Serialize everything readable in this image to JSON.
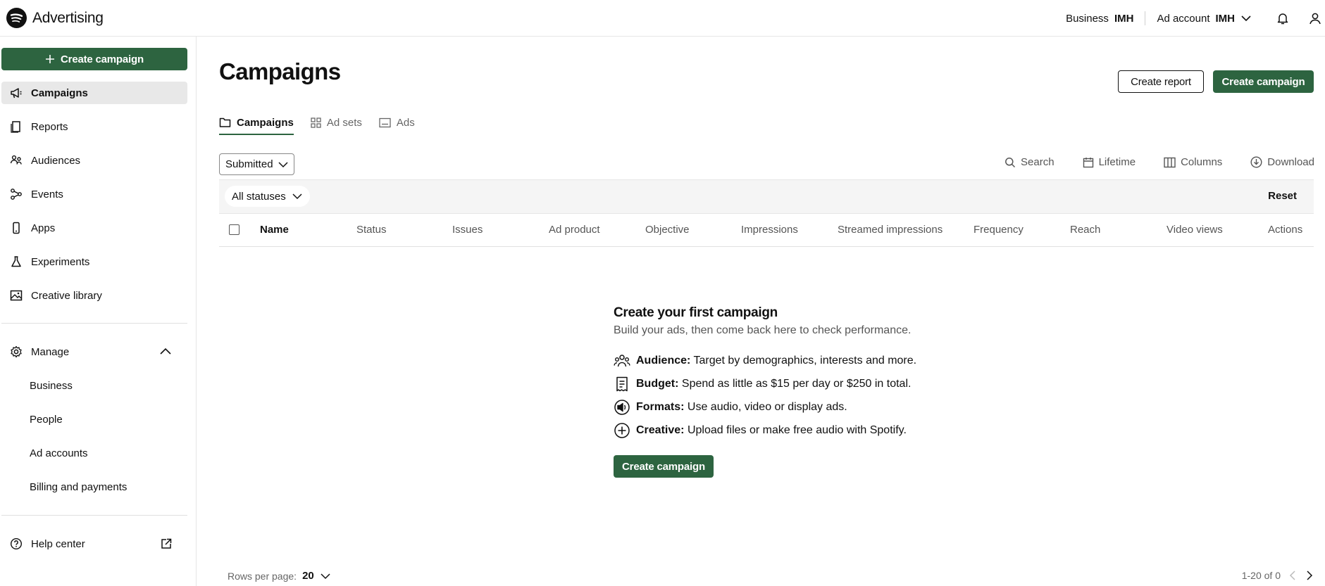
{
  "app": {
    "title": "Advertising",
    "logo_icon": "spotify-logo-icon"
  },
  "topbar": {
    "business_label": "Business",
    "business_value": "IMH",
    "ad_account_label": "Ad account",
    "ad_account_value": "IMH",
    "icons": [
      "chevron-down-icon",
      "bell-icon",
      "user-icon"
    ]
  },
  "sidebar": {
    "create_label": "Create campaign",
    "items": [
      {
        "label": "Campaigns",
        "icon": "megaphone-icon",
        "active": true
      },
      {
        "label": "Reports",
        "icon": "report-icon"
      },
      {
        "label": "Audiences",
        "icon": "audiences-icon"
      },
      {
        "label": "Events",
        "icon": "events-icon"
      },
      {
        "label": "Apps",
        "icon": "phone-icon"
      },
      {
        "label": "Experiments",
        "icon": "flask-icon"
      },
      {
        "label": "Creative library",
        "icon": "image-icon"
      }
    ],
    "manage": {
      "label": "Manage",
      "icon": "gear-icon",
      "children": [
        "Business",
        "People",
        "Ad accounts",
        "Billing and payments"
      ]
    },
    "help": {
      "label": "Help center",
      "icon": "help-icon"
    }
  },
  "main": {
    "title": "Campaigns",
    "create_report_label": "Create report",
    "create_campaign_label": "Create campaign",
    "tabs": [
      {
        "label": "Campaigns",
        "active": true,
        "icon": "folder-icon"
      },
      {
        "label": "Ad sets",
        "icon": "grid-icon"
      },
      {
        "label": "Ads",
        "icon": "ad-icon"
      }
    ],
    "filter_value": "Submitted",
    "tools": [
      {
        "label": "Search",
        "icon": "search-icon"
      },
      {
        "label": "Lifetime",
        "icon": "calendar-icon"
      },
      {
        "label": "Columns",
        "icon": "columns-icon"
      },
      {
        "label": "Download",
        "icon": "download-icon"
      }
    ],
    "status_filter": "All statuses",
    "reset_label": "Reset",
    "columns": [
      "Name",
      "Status",
      "Issues",
      "Ad product",
      "Objective",
      "Impressions",
      "Streamed impressions",
      "Frequency",
      "Reach",
      "Video views",
      "Actions"
    ],
    "empty_state": {
      "title": "Create your first campaign",
      "subtitle": "Build your ads, then come back here to check performance.",
      "features": [
        {
          "label": "Audience:",
          "text": "Target by demographics, interests and more.",
          "icon": "audience-icon"
        },
        {
          "label": "Budget:",
          "text": "Spend as little as $15 per day or $250 in total.",
          "icon": "receipt-icon"
        },
        {
          "label": "Formats:",
          "text": "Use audio, video or display ads.",
          "icon": "speaker-icon"
        },
        {
          "label": "Creative:",
          "text": "Upload files or make free audio with Spotify.",
          "icon": "plus-circle-icon"
        }
      ],
      "cta_label": "Create campaign"
    },
    "footer": {
      "rows_per_page_label": "Rows per page:",
      "rows_per_page_value": "20",
      "range": "1-20 of 0"
    }
  },
  "colors": {
    "primary": "#2d6440",
    "active_bg": "#e8e8e8",
    "muted_text": "#555555"
  }
}
